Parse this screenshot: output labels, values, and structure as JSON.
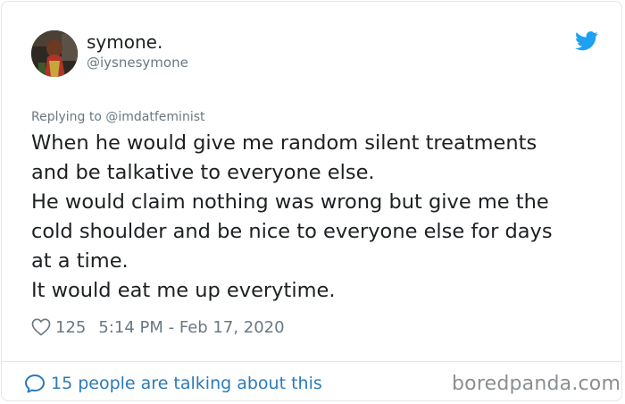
{
  "author": {
    "display_name": "symone.",
    "handle": "@iysnesymone"
  },
  "reply": {
    "prefix": "Replying to ",
    "mention": "@imdatfeminist"
  },
  "tweet": {
    "lines": [
      "When he would give me random silent treatments",
      "and be talkative to everyone else.",
      "He would claim nothing was wrong but give me the",
      "cold shoulder and be nice to everyone else for days",
      "at a time.",
      "It would eat me up everytime."
    ]
  },
  "meta": {
    "likes": "125",
    "timestamp": "5:14 PM - Feb 17, 2020"
  },
  "footer": {
    "talking_label": "15 people are talking about this",
    "watermark": "boredpanda.com"
  },
  "icons": {
    "twitter": "twitter-bird-icon",
    "heart": "heart-icon",
    "bubble": "speech-bubble-icon"
  },
  "colors": {
    "twitter_blue": "#1da1f2",
    "link_blue": "#2b7bb9",
    "text_primary": "#1c2022",
    "text_secondary": "#697882"
  }
}
